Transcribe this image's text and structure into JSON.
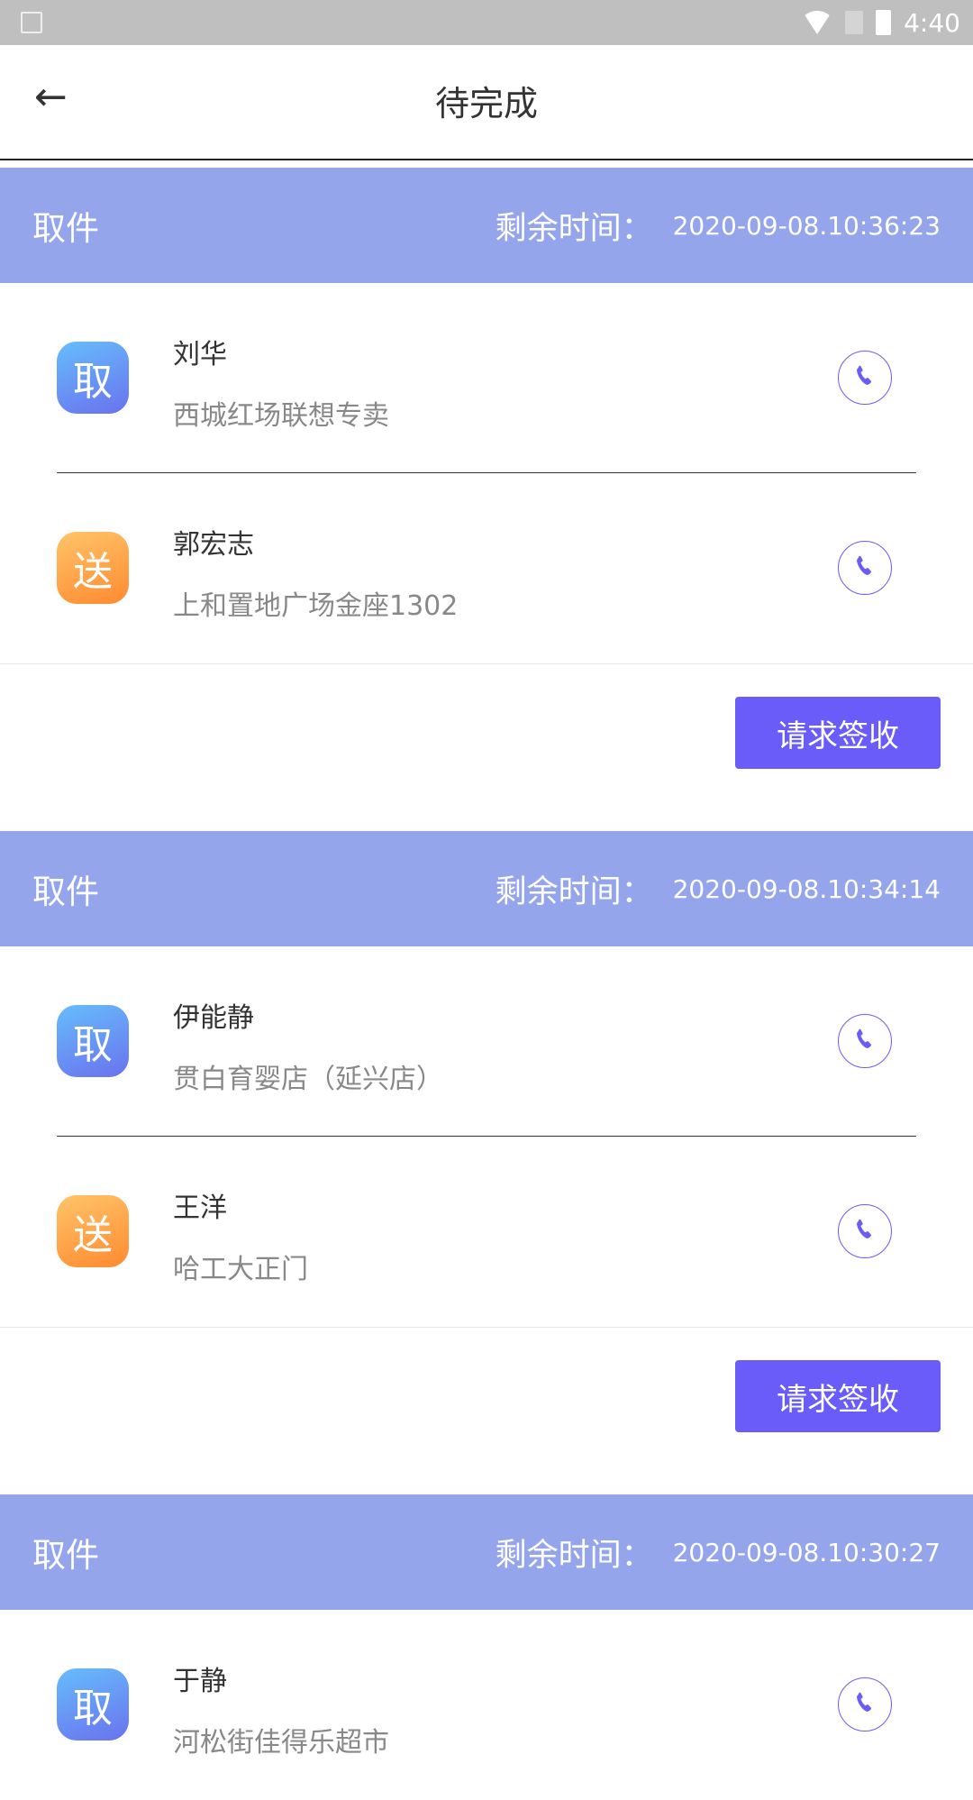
{
  "status_bar": {
    "time": "4:40",
    "icons": [
      "image-icon",
      "wifi-icon",
      "no-sim-icon",
      "battery-charging-icon"
    ]
  },
  "header": {
    "title": "待完成",
    "back_icon": "arrow-left-icon"
  },
  "colors": {
    "band": "#95a5ec",
    "accent": "#6a5cf9",
    "pickup_badge": "#6a8cf4",
    "deliver_badge": "#ffa040"
  },
  "orders": [
    {
      "type": "取件",
      "remaining_label": "剩余时间：",
      "remaining_time": "2020-09-08.10:36:23",
      "button": "请求签收",
      "stops": [
        {
          "badge": "取",
          "kind": "pick",
          "name": "刘华",
          "address": "西城红场联想专卖"
        },
        {
          "badge": "送",
          "kind": "send",
          "name": "郭宏志",
          "address": "上和置地广场金座1302"
        }
      ]
    },
    {
      "type": "取件",
      "remaining_label": "剩余时间：",
      "remaining_time": "2020-09-08.10:34:14",
      "button": "请求签收",
      "stops": [
        {
          "badge": "取",
          "kind": "pick",
          "name": "伊能静",
          "address": "贯白育婴店（延兴店）"
        },
        {
          "badge": "送",
          "kind": "send",
          "name": "王洋",
          "address": "哈工大正门"
        }
      ]
    },
    {
      "type": "取件",
      "remaining_label": "剩余时间：",
      "remaining_time": "2020-09-08.10:30:27",
      "stops": [
        {
          "badge": "取",
          "kind": "pick",
          "name": "于静",
          "address": "河松街佳得乐超市"
        }
      ]
    }
  ]
}
